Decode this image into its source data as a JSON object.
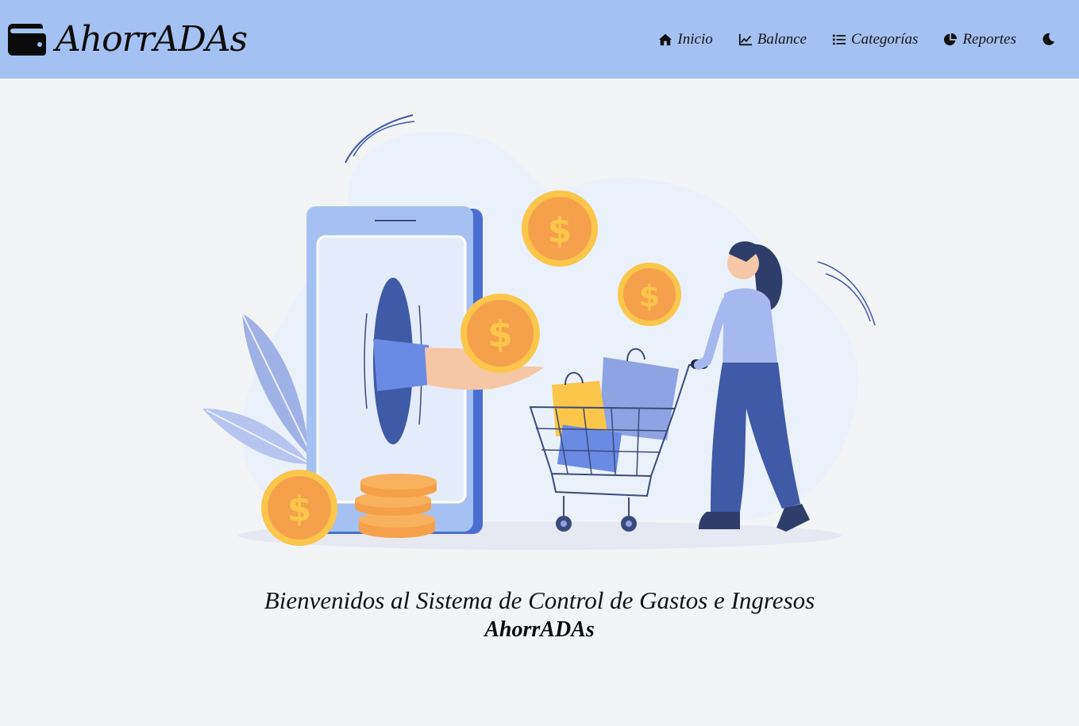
{
  "header": {
    "brand": "AhorrADAs",
    "brand_icon": "wallet-icon",
    "nav": [
      {
        "label": "Inicio",
        "icon": "home-icon"
      },
      {
        "label": "Balance",
        "icon": "chart-line-icon"
      },
      {
        "label": "Categorías",
        "icon": "list-icon"
      },
      {
        "label": "Reportes",
        "icon": "pie-chart-icon"
      }
    ],
    "theme_toggle_icon": "moon-icon"
  },
  "main": {
    "welcome_text": "Bienvenidos al Sistema de Control de Gastos e Ingresos",
    "welcome_brand": "AhorrADAs"
  },
  "colors": {
    "navbar": "#a3c2f2",
    "background": "#f3f4f6",
    "coin": "#f5a04a",
    "coin_rim": "#fbc64a",
    "accent_blue": "#3f5aa6"
  }
}
